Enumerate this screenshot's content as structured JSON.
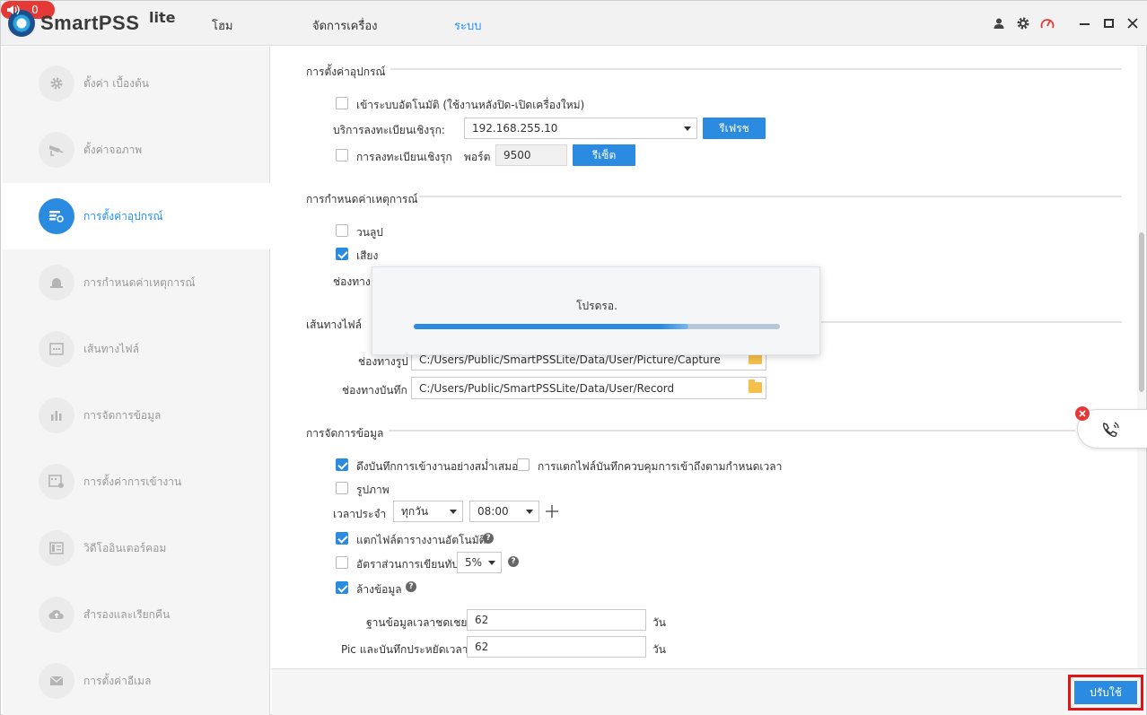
{
  "header": {
    "app_name": "SmartPSS",
    "app_suffix": "lite",
    "nav": [
      "โฮม",
      "จัดการเครื่อง",
      "ระบบ"
    ],
    "active_nav": "ระบบ",
    "alarm_count": "0",
    "icons": [
      "speaker-icon",
      "user-icon",
      "gear-icon",
      "performance-icon",
      "minimize-icon",
      "maximize-icon",
      "close-icon"
    ]
  },
  "sidebar": {
    "items": [
      {
        "label": "ตั้งค่า เบื้องต้น",
        "icon": "gear-icon"
      },
      {
        "label": "ตั้งค่าจอภาพ",
        "icon": "camera-icon"
      },
      {
        "label": "การตั้งค่าอุปกรณ์",
        "icon": "device-settings-icon",
        "active": true
      },
      {
        "label": "การกำหนดค่าเหตุการณ์",
        "icon": "alarm-icon"
      },
      {
        "label": "เส้นทางไฟล์",
        "icon": "path-icon"
      },
      {
        "label": "การจัดการข้อมูล",
        "icon": "chart-icon"
      },
      {
        "label": "การตั้งค่าการเข้างาน",
        "icon": "attendance-icon"
      },
      {
        "label": "วิดีโออินเตอร์คอม",
        "icon": "intercom-icon"
      },
      {
        "label": "สำรองและเรียกคืน",
        "icon": "cloud-upload-icon"
      },
      {
        "label": "การตั้งค่าอีเมล",
        "icon": "mail-icon"
      }
    ]
  },
  "device": {
    "title": "การตั้งค่าอุปกรณ์",
    "auto_login": "เข้าระบบอัตโนมัติ (ใช้งานหลังปิด-เปิดเครื่องใหม่)",
    "auto_login_checked": false,
    "reg_service_label": "บริการลงทะเบียนเชิงรุก:",
    "reg_service_value": "192.168.255.10",
    "refresh": "รีเฟรช",
    "reg_label": "การลงทะเบียนเชิงรุก",
    "reg_checked": false,
    "port_label": "พอร์ต",
    "port_value": "9500",
    "reset": "รีเซ็ต"
  },
  "event": {
    "title": "การกำหนดค่าเหตุการณ์",
    "loop": "วนลูป",
    "loop_checked": false,
    "sound": "เสียง",
    "sound_checked": true,
    "path_label_partial": "ช่องทาง"
  },
  "filepath": {
    "title": "เส้นทางไฟล์",
    "picture_label": "ช่องทางรูป",
    "picture_value": "C:/Users/Public/SmartPSSLite/Data/User/Picture/Capture",
    "record_label": "ช่องทางบันทึก",
    "record_value": "C:/Users/Public/SmartPSSLite/Data/User/Record"
  },
  "data_mgmt": {
    "title": "การจัดการข้อมูล",
    "pull_attendance": "ดึงบันทึกการเข้างานอย่างสม่ำเสมอ",
    "pull_attendance_checked": true,
    "split_file": "การแตกไฟล์บันทึกควบคุมการเข้าถึงตามกำหนดเวลา",
    "split_file_checked": false,
    "picture": "รูปภาพ",
    "picture_checked": false,
    "schedule_label": "เวลาประจำ",
    "schedule_day": "ทุกวัน",
    "schedule_time": "08:00",
    "auto_split_report": "แตกไฟล์ตารางงานอัตโนมัติ",
    "auto_split_checked": true,
    "overwrite_ratio": "อัตราส่วนการเขียนทับ",
    "overwrite_checked": false,
    "overwrite_value": "5%",
    "clear_data": "ล้างข้อมูล",
    "clear_checked": true,
    "db_expire_label": "ฐานข้อมูลเวลาชดเชย",
    "db_expire_value": "62",
    "pic_expire_label": "Pic และบันทึกประหยัดเวลา",
    "pic_expire_value": "62",
    "unit": "วัน"
  },
  "dialog": {
    "text": "โปรดรอ.",
    "progress": 0.75
  },
  "footer": {
    "apply": "ปรับใช้"
  },
  "colors": {
    "accent": "#2a8be0",
    "alarm": "#e53935",
    "highlight_box": "#e01616"
  }
}
